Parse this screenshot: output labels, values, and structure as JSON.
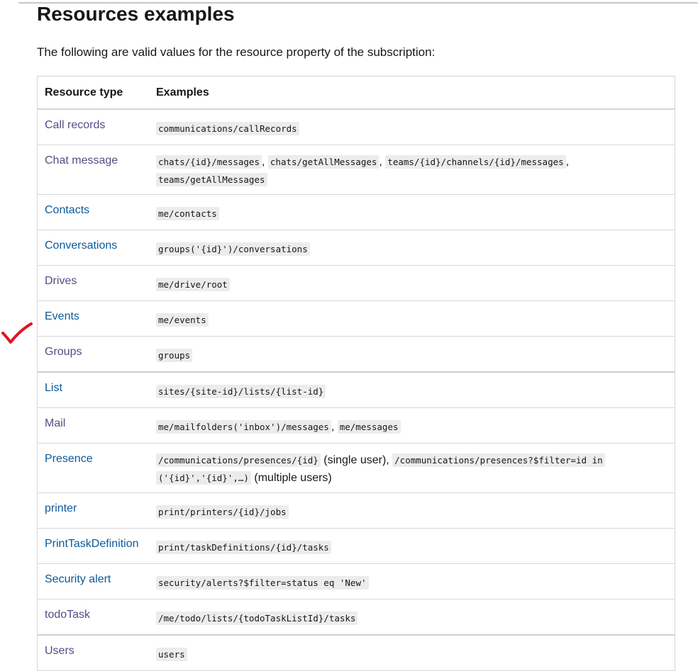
{
  "page": {
    "title": "Resources examples",
    "intro": "The following are valid values for the resource property of the subscription:"
  },
  "table": {
    "headers": [
      "Resource type",
      "Examples"
    ],
    "rows": [
      {
        "type": "Call records",
        "examples": [
          "communications/callRecords"
        ]
      },
      {
        "type": "Chat message",
        "examples": [
          "chats/{id}/messages",
          "chats/getAllMessages",
          "teams/{id}/channels/{id}/messages",
          "teams/getAllMessages"
        ]
      },
      {
        "type": "Contacts",
        "examples": [
          "me/contacts"
        ]
      },
      {
        "type": "Conversations",
        "examples": [
          "groups('{id}')/conversations"
        ]
      },
      {
        "type": "Drives",
        "examples": [
          "me/drive/root"
        ]
      },
      {
        "type": "Events",
        "examples": [
          "me/events"
        ]
      },
      {
        "type": "Groups",
        "examples": [
          "groups"
        ]
      },
      {
        "type": "List",
        "examples": [
          "sites/{site-id}/lists/{list-id}"
        ]
      },
      {
        "type": "Mail",
        "examples": [
          "me/mailfolders('inbox')/messages",
          "me/messages"
        ]
      },
      {
        "type": "Presence",
        "examples": [
          "/communications/presences/{id}",
          "/communications/presences?$filter=id in",
          "('{id}','{id}',…)"
        ],
        "notes": [
          "(single user)",
          "(multiple users)"
        ]
      },
      {
        "type": "printer",
        "examples": [
          "print/printers/{id}/jobs"
        ]
      },
      {
        "type": "PrintTaskDefinition",
        "examples": [
          "print/taskDefinitions/{id}/tasks"
        ]
      },
      {
        "type": "Security alert",
        "examples": [
          "security/alerts?$filter=status eq 'New'"
        ]
      },
      {
        "type": "todoTask",
        "examples": [
          "/me/todo/lists/{todoTaskListId}/tasks"
        ]
      },
      {
        "type": "Users",
        "examples": [
          "users"
        ]
      }
    ]
  },
  "colors": {
    "link": "#0b5a9a",
    "visited_link": "#5c4a86",
    "annotation": "#e0141e"
  },
  "annotation": {
    "icon": "checkmark-icon"
  }
}
